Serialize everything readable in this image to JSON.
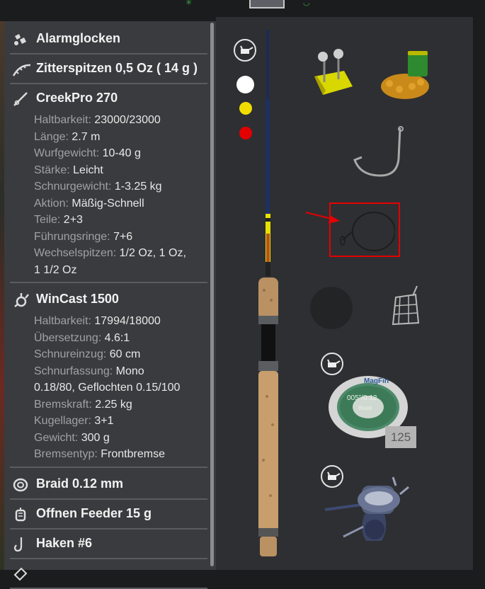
{
  "list": [
    {
      "icon": "bell-icon",
      "title": "Alarmglocken"
    },
    {
      "icon": "quiver-tip-icon",
      "title": "Zitterspitzen 0,5 Oz ( 14 g )"
    },
    {
      "icon": "rod-icon",
      "title": "CreekPro 270",
      "details": [
        {
          "k": "Haltbarkeit: ",
          "v": "23000/23000"
        },
        {
          "k": "Länge: ",
          "v": "2.7 m"
        },
        {
          "k": "Wurfgewicht: ",
          "v": "10-40 g"
        },
        {
          "k": "Stärke: ",
          "v": "Leicht"
        },
        {
          "k": "Schnurgewicht: ",
          "v": "1-3.25 kg"
        },
        {
          "k": "Aktion: ",
          "v": "Mäßig-Schnell"
        },
        {
          "k": "Teile: ",
          "v": "2+3"
        },
        {
          "k": "Führungsringe: ",
          "v": "7+6"
        },
        {
          "k": "Wechselspitzen: ",
          "v": "1/2 Oz, 1 Oz,"
        },
        {
          "k": "",
          "v": "1 1/2 Oz"
        }
      ]
    },
    {
      "icon": "reel-icon",
      "title": "WinCast 1500",
      "details": [
        {
          "k": "Haltbarkeit: ",
          "v": "17994/18000"
        },
        {
          "k": "Übersetzung: ",
          "v": "4.6:1"
        },
        {
          "k": "Schnureinzug: ",
          "v": "60 cm"
        },
        {
          "k": "Schnurfassung: ",
          "v": "Mono"
        },
        {
          "k": "",
          "v": "0.18/80, Geflochten 0.15/100"
        },
        {
          "k": "Bremskraft: ",
          "v": "2.25 kg"
        },
        {
          "k": "Kugellager: ",
          "v": "3+1"
        },
        {
          "k": "Gewicht: ",
          "v": "300 g"
        },
        {
          "k": "Bremsentyp: ",
          "v": "Frontbremse"
        }
      ]
    },
    {
      "icon": "line-spool-icon",
      "title": "Braid 0.12 mm"
    },
    {
      "icon": "feeder-icon",
      "title": "Offnen Feeder 15 g"
    },
    {
      "icon": "hook-icon",
      "title": "Haken #6"
    }
  ],
  "spool": {
    "count": "125",
    "label_brand": "MagFin",
    "label_size": "005\"/0.12",
    "label_type": "Braid"
  },
  "rod_brand": "CreekPro"
}
